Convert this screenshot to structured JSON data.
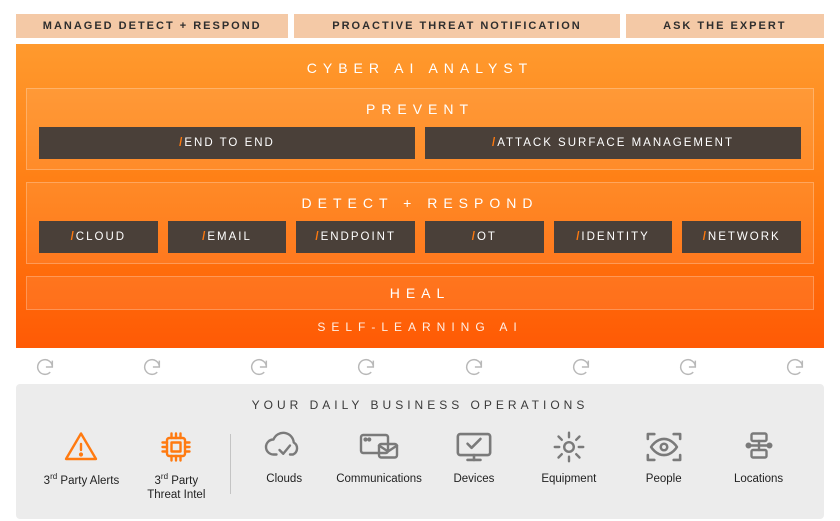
{
  "top": {
    "tabs": [
      "MANAGED DETECT + RESPOND",
      "PROACTIVE THREAT NOTIFICATION",
      "ASK THE EXPERT"
    ]
  },
  "analyst": "CYBER AI ANALYST",
  "prevent": {
    "title": "PREVENT",
    "items": [
      "END TO END",
      "ATTACK SURFACE MANAGEMENT"
    ]
  },
  "detect": {
    "title": "DETECT + RESPOND",
    "items": [
      "CLOUD",
      "EMAIL",
      "ENDPOINT",
      "OT",
      "IDENTITY",
      "NETWORK"
    ]
  },
  "heal": "HEAL",
  "selfai": "SELF-LEARNING AI",
  "ops": {
    "title": "YOUR DAILY BUSINESS OPERATIONS",
    "left": [
      {
        "label_html": "3<sup>rd</sup> Party Alerts",
        "icon": "alert-triangle-icon"
      },
      {
        "label_html": "3<sup>rd</sup> Party<br>Threat Intel",
        "icon": "chip-icon"
      }
    ],
    "right": [
      {
        "label": "Clouds",
        "icon": "cloud-check-icon"
      },
      {
        "label": "Communications",
        "icon": "mail-window-icon"
      },
      {
        "label": "Devices",
        "icon": "device-check-icon"
      },
      {
        "label": "Equipment",
        "icon": "gear-icon"
      },
      {
        "label": "People",
        "icon": "eye-scan-icon"
      },
      {
        "label": "Locations",
        "icon": "server-stack-icon"
      }
    ]
  },
  "colors": {
    "accent": "#ff7a10",
    "chip_bg": "#4a4039",
    "top_tab_bg": "#f4c9a6",
    "ops_bg": "#ececec"
  }
}
